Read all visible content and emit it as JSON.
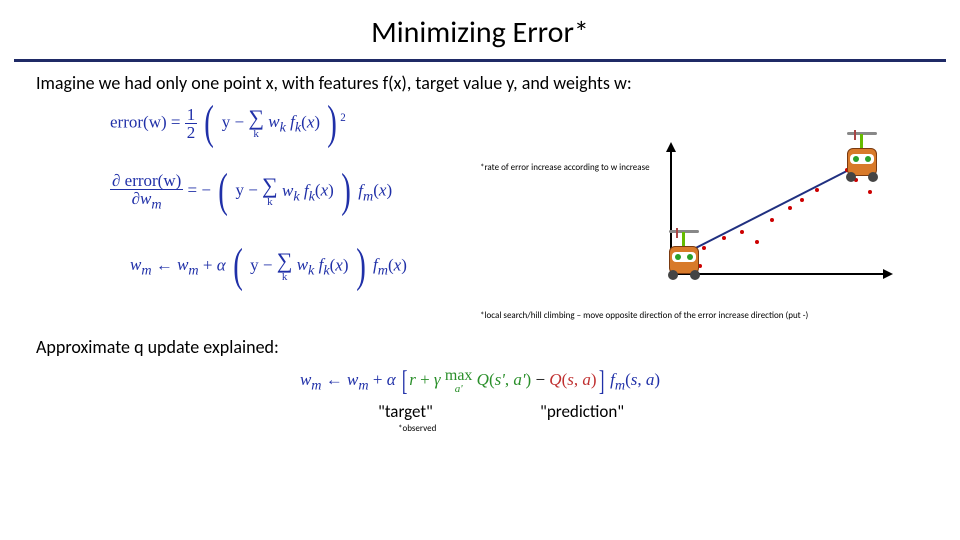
{
  "title": "Minimizing Error*",
  "intro": "Imagine we had only one point x, with features f(x), target value y, and weights w:",
  "equations": {
    "err_lhs": "error(w)",
    "err_rhs_frac_top": "1",
    "err_rhs_frac_bot": "2",
    "y": "y",
    "minus": "−",
    "sum_sub": "k",
    "sum_term": "w_k f_k(x)",
    "sq": "2",
    "deriv_top": "∂ error(w)",
    "deriv_bot": "∂w_m",
    "eq": "=",
    "neg": "−",
    "fm": "f_m(x)",
    "update_lhs": "w_m",
    "arrow": "←",
    "alpha": "α",
    "plus": "+"
  },
  "notes": {
    "rate": "*rate of error increase according to w increase",
    "local": "*local search/hill climbing – move opposite direction of the error increase direction (put -)"
  },
  "explained": "Approximate q update explained:",
  "q_equation": {
    "wm": "w_m",
    "arrow": "←",
    "plus": "+",
    "alpha": "α",
    "r": "r",
    "gamma": "γ",
    "max_label": "max",
    "max_sub": "a'",
    "Qsp": "Q(s', a')",
    "minus": "−",
    "Qsa": "Q(s, a)",
    "fmsa": "f_m(s, a)"
  },
  "labels": {
    "target": "\"target\"",
    "observed": "*observed",
    "prediction": "\"prediction\""
  }
}
